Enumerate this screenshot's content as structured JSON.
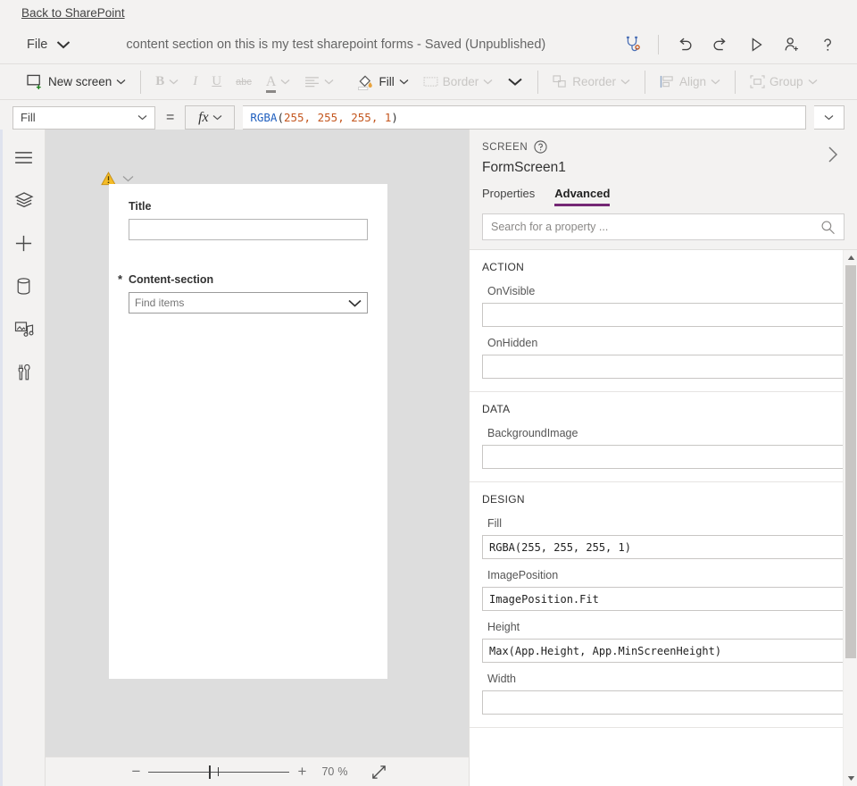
{
  "topbar": {
    "back_link": "Back to SharePoint"
  },
  "commandbar": {
    "file_label": "File",
    "doc_title": "content section on this is my test sharepoint forms - Saved (Unpublished)",
    "actions": [
      {
        "name": "app-checker-icon",
        "title": "App checker"
      },
      {
        "name": "undo-icon",
        "title": "Undo"
      },
      {
        "name": "redo-icon",
        "title": "Redo"
      },
      {
        "name": "preview-icon",
        "title": "Preview the app"
      },
      {
        "name": "share-icon",
        "title": "Share"
      },
      {
        "name": "help-icon",
        "title": "Help"
      }
    ]
  },
  "ribbon": {
    "new_screen": "New screen",
    "bold": "B",
    "italic": "I",
    "underline": "U",
    "strikethrough": "abc",
    "font_color": "A",
    "fill": "Fill",
    "border": "Border",
    "reorder": "Reorder",
    "align": "Align",
    "group": "Group"
  },
  "formula_bar": {
    "property": "Fill",
    "equals": "=",
    "fx": "fx",
    "formula_fn": "RGBA",
    "formula_open": "(",
    "formula_args": "255, 255, 255, 1",
    "formula_close": ")",
    "formula_full": "RGBA(255, 255, 255, 1)"
  },
  "rail": [
    {
      "name": "sidebar-item-menu",
      "icon": "hamburger-icon"
    },
    {
      "name": "sidebar-item-tree-view",
      "icon": "layers-icon"
    },
    {
      "name": "sidebar-item-insert",
      "icon": "plus-icon"
    },
    {
      "name": "sidebar-item-data",
      "icon": "database-icon"
    },
    {
      "name": "sidebar-item-media",
      "icon": "media-icon"
    },
    {
      "name": "sidebar-item-advanced-tools",
      "icon": "tools-icon"
    }
  ],
  "canvas": {
    "warning_icon": "warning-triangle-icon",
    "fields": [
      {
        "label": "Title",
        "required": false,
        "type": "text",
        "value": "",
        "placeholder": ""
      },
      {
        "label": "Content-section",
        "required": true,
        "required_mark": "*",
        "type": "combobox",
        "value": "",
        "placeholder": "Find items"
      }
    ],
    "zoom": {
      "minus": "−",
      "plus": "+",
      "value": "70",
      "percent": "%",
      "fit_icon": "fit-to-screen-icon"
    }
  },
  "panel": {
    "kind": "SCREEN",
    "name": "FormScreen1",
    "tabs": [
      {
        "label": "Properties",
        "active": false
      },
      {
        "label": "Advanced",
        "active": true
      }
    ],
    "accent_color": "#742774",
    "search_placeholder": "Search for a property ...",
    "sections": [
      {
        "title": "ACTION",
        "properties": [
          {
            "label": "OnVisible",
            "value": ""
          },
          {
            "label": "OnHidden",
            "value": ""
          }
        ]
      },
      {
        "title": "DATA",
        "properties": [
          {
            "label": "BackgroundImage",
            "value": ""
          }
        ]
      },
      {
        "title": "DESIGN",
        "properties": [
          {
            "label": "Fill",
            "value": "RGBA(255, 255, 255, 1)"
          },
          {
            "label": "ImagePosition",
            "value": "ImagePosition.Fit"
          },
          {
            "label": "Height",
            "value": "Max(App.Height, App.MinScreenHeight)"
          },
          {
            "label": "Width",
            "value": ""
          }
        ]
      }
    ]
  }
}
